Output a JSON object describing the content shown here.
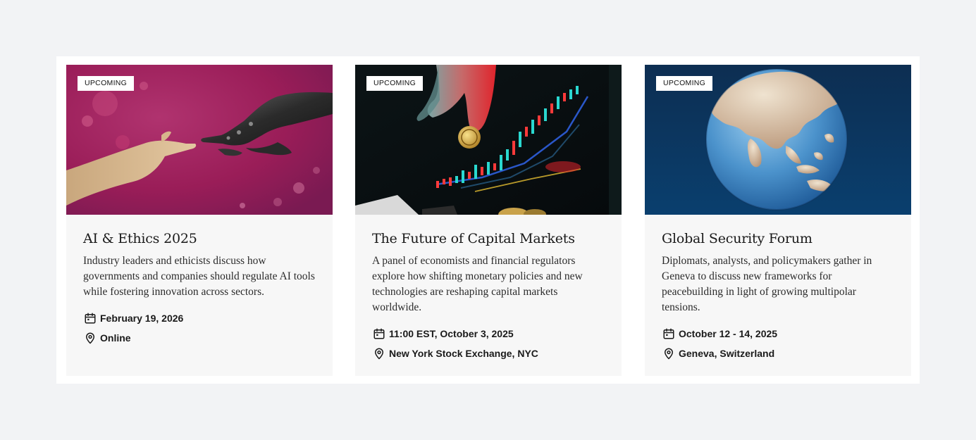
{
  "events": [
    {
      "badge": "UPCOMING",
      "title": "AI & Ethics 2025",
      "description": "Industry leaders and ethicists discuss how governments and companies should regulate AI tools while fostering innovation across sectors.",
      "date": "February 19, 2026",
      "location": "Online",
      "image": "human-hand-touching-robot-hand",
      "icons": {
        "date": "calendar-icon",
        "location": "map-pin-icon"
      }
    },
    {
      "badge": "UPCOMING",
      "title": "The Future of Capital Markets",
      "description": "A panel of economists and financial regulators explore how shifting monetary policies and new technologies are reshaping capital markets worldwide.",
      "date": "11:00 EST, October 3, 2025",
      "location": "New York Stock Exchange, NYC",
      "image": "hand-placing-coin-over-stock-chart",
      "icons": {
        "date": "calendar-icon",
        "location": "map-pin-icon"
      }
    },
    {
      "badge": "UPCOMING",
      "title": "Global Security Forum",
      "description": "Diplomats, analysts, and policymakers gather in Geneva to discuss new frameworks for peacebuilding in light of growing multipolar tensions.",
      "date": "October 12 - 14, 2025",
      "location": "Geneva, Switzerland",
      "image": "earth-globe-asia",
      "icons": {
        "date": "calendar-icon",
        "location": "map-pin-icon"
      }
    }
  ],
  "colors": {
    "page_bg": "#f2f3f5",
    "panel_bg": "#ffffff",
    "card_bg": "#f7f7f7",
    "text": "#1a1a1a"
  }
}
